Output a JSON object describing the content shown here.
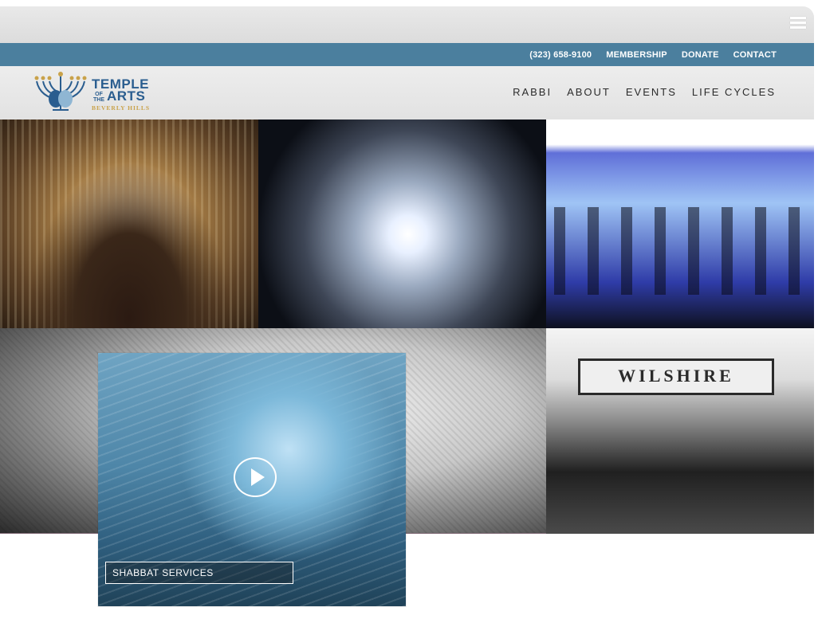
{
  "utility_nav": {
    "phone": "(323) 658-9100",
    "membership": "MEMBERSHIP",
    "donate": "DONATE",
    "contact": "CONTACT"
  },
  "logo": {
    "line1": "TEMPLE",
    "of_the": "OF THE",
    "line2": "ARTS",
    "subline": "BEVERLY HILLS"
  },
  "main_nav": {
    "items": [
      "RABBI",
      "ABOUT",
      "EVENTS",
      "LIFE CYCLES"
    ]
  },
  "tiles": {
    "marquee_text": "WILSHIRE",
    "caption": "SHABBAT SERVICES"
  },
  "colors": {
    "utility_bar": "#4b7f9e",
    "logo_blue": "#2a5d8f",
    "logo_gold": "#c9a24a"
  },
  "icons": {
    "menu": "hamburger-menu-icon",
    "play": "play-circle-icon"
  }
}
